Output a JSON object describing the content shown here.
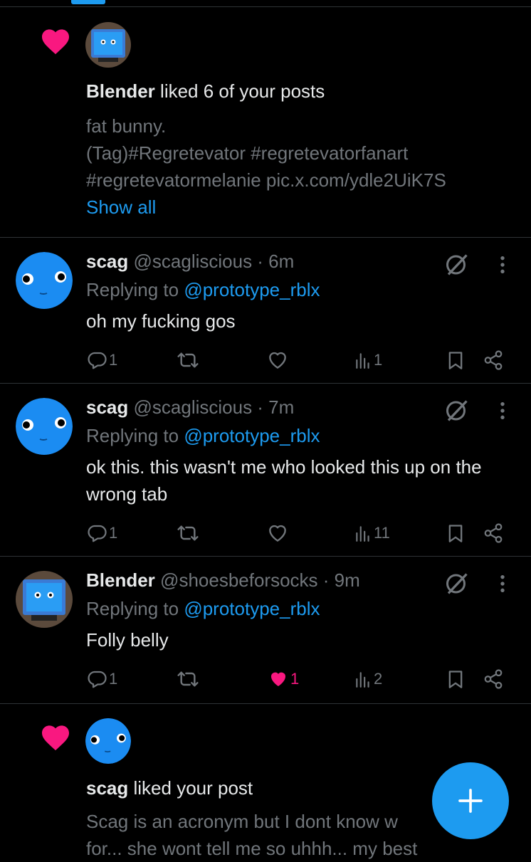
{
  "colors": {
    "background": "#000000",
    "text": "#e7e9ea",
    "muted": "#71767b",
    "accent": "#1d9bf0",
    "like": "#f91880",
    "divider": "#2f3336"
  },
  "notifications": [
    {
      "icon": "heart-icon",
      "user": "Blender",
      "action": "liked 6 of your posts",
      "preview_line1": "fat bunny.",
      "preview_line2": "(Tag)#Regretevator #regretevatorfanart",
      "preview_line3": "#regretevatormelanie pic.x.com/ydle2UiK7S",
      "show_all": "Show all"
    },
    {
      "icon": "heart-icon",
      "user": "scag",
      "action": "liked your post",
      "preview_line1": "Scag is an acronym but I dont know w",
      "preview_line2": "for... she wont tell me so uhhh... my best"
    }
  ],
  "replies": [
    {
      "name": "scag",
      "handle": "@scagliscious",
      "time": "6m",
      "replying_prefix": "Replying to ",
      "replying_to": "@prototype_rblx",
      "text": "oh my fucking gos",
      "replies": "1",
      "likes": "",
      "views": "1"
    },
    {
      "name": "scag",
      "handle": "@scagliscious",
      "time": "7m",
      "replying_prefix": "Replying to ",
      "replying_to": "@prototype_rblx",
      "text": "ok this. this wasn't me who looked this up on the wrong tab",
      "replies": "1",
      "likes": "",
      "views": "11"
    },
    {
      "name": "Blender",
      "handle": "@shoesbeforsocks",
      "time": "9m",
      "replying_prefix": "Replying to ",
      "replying_to": "@prototype_rblx",
      "text": "Folly belly",
      "replies": "1",
      "likes": "1",
      "views": "2"
    }
  ],
  "separator": " · ",
  "fab_icon": "plus-icon"
}
